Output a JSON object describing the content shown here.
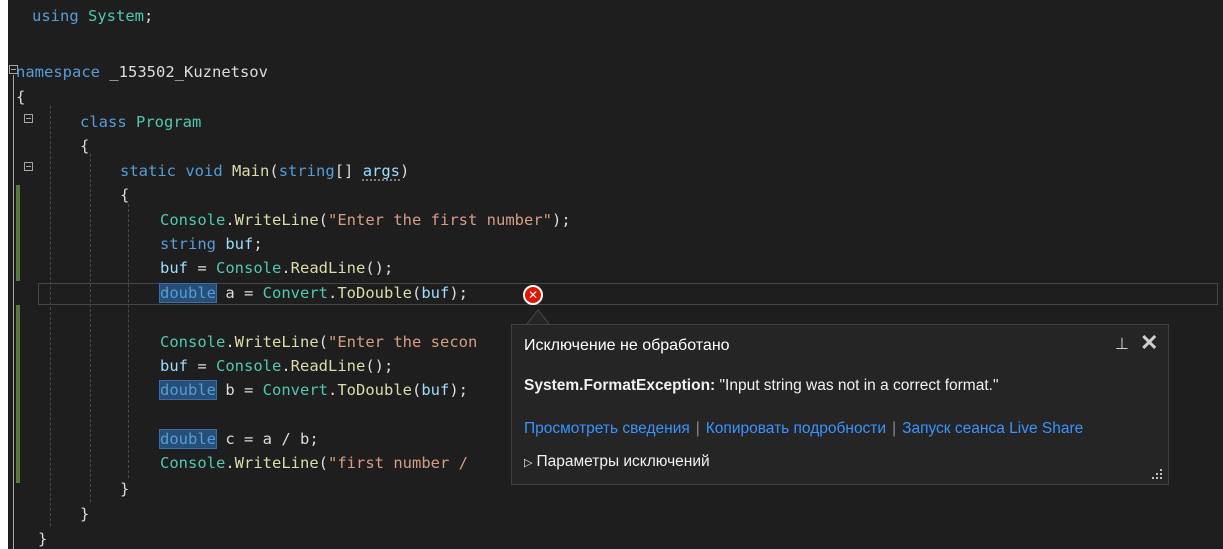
{
  "editor": {
    "lines": [
      {
        "id": "using",
        "tokens": [
          {
            "t": "using",
            "c": "kw"
          },
          {
            "t": " ",
            "c": "plain"
          },
          {
            "t": "System",
            "c": "ty"
          },
          {
            "t": ";",
            "c": "plain"
          }
        ]
      },
      {
        "id": "namespace",
        "tokens": [
          {
            "t": "namespace",
            "c": "kw"
          },
          {
            "t": " _153502_Kuznetsov",
            "c": "plain"
          }
        ]
      },
      {
        "id": "ns-open",
        "tokens": [
          {
            "t": "{",
            "c": "plain"
          }
        ]
      },
      {
        "id": "class",
        "tokens": [
          {
            "t": "class",
            "c": "kw"
          },
          {
            "t": " ",
            "c": "plain"
          },
          {
            "t": "Program",
            "c": "ty"
          }
        ]
      },
      {
        "id": "class-open",
        "tokens": [
          {
            "t": "{",
            "c": "plain"
          }
        ]
      },
      {
        "id": "main",
        "tokens": [
          {
            "t": "static",
            "c": "kw"
          },
          {
            "t": " ",
            "c": "plain"
          },
          {
            "t": "void",
            "c": "kw"
          },
          {
            "t": " ",
            "c": "plain"
          },
          {
            "t": "Main",
            "c": "meth"
          },
          {
            "t": "(",
            "c": "plain"
          },
          {
            "t": "string",
            "c": "kw"
          },
          {
            "t": "[] ",
            "c": "plain"
          },
          {
            "t": "args",
            "c": "var squig"
          },
          {
            "t": ")",
            "c": "plain"
          }
        ]
      },
      {
        "id": "main-open",
        "tokens": [
          {
            "t": "{",
            "c": "plain"
          }
        ]
      },
      {
        "id": "wl1",
        "tokens": [
          {
            "t": "Console",
            "c": "ty"
          },
          {
            "t": ".",
            "c": "plain"
          },
          {
            "t": "WriteLine",
            "c": "meth"
          },
          {
            "t": "(",
            "c": "plain"
          },
          {
            "t": "\"Enter the first number\"",
            "c": "str"
          },
          {
            "t": ");",
            "c": "plain"
          }
        ]
      },
      {
        "id": "decl-buf",
        "tokens": [
          {
            "t": "string",
            "c": "kw"
          },
          {
            "t": " ",
            "c": "plain"
          },
          {
            "t": "buf",
            "c": "var"
          },
          {
            "t": ";",
            "c": "plain"
          }
        ]
      },
      {
        "id": "read1",
        "tokens": [
          {
            "t": "buf",
            "c": "var"
          },
          {
            "t": " = ",
            "c": "plain"
          },
          {
            "t": "Console",
            "c": "ty"
          },
          {
            "t": ".",
            "c": "plain"
          },
          {
            "t": "ReadLine",
            "c": "meth"
          },
          {
            "t": "();",
            "c": "plain"
          }
        ]
      },
      {
        "id": "decl-a",
        "tokens": [
          {
            "t": "double",
            "c": "kw sel"
          },
          {
            "t": " a = ",
            "c": "plain"
          },
          {
            "t": "Convert",
            "c": "ty"
          },
          {
            "t": ".",
            "c": "plain"
          },
          {
            "t": "ToDouble",
            "c": "meth"
          },
          {
            "t": "(",
            "c": "plain"
          },
          {
            "t": "buf",
            "c": "var"
          },
          {
            "t": ");",
            "c": "plain"
          }
        ]
      },
      {
        "id": "blank1",
        "tokens": []
      },
      {
        "id": "wl2",
        "tokens": [
          {
            "t": "Console",
            "c": "ty"
          },
          {
            "t": ".",
            "c": "plain"
          },
          {
            "t": "WriteLine",
            "c": "meth"
          },
          {
            "t": "(",
            "c": "plain"
          },
          {
            "t": "\"Enter the secon",
            "c": "str"
          }
        ]
      },
      {
        "id": "read2",
        "tokens": [
          {
            "t": "buf",
            "c": "var"
          },
          {
            "t": " = ",
            "c": "plain"
          },
          {
            "t": "Console",
            "c": "ty"
          },
          {
            "t": ".",
            "c": "plain"
          },
          {
            "t": "ReadLine",
            "c": "meth"
          },
          {
            "t": "();",
            "c": "plain"
          }
        ]
      },
      {
        "id": "decl-b",
        "tokens": [
          {
            "t": "double",
            "c": "kw sel"
          },
          {
            "t": " b = ",
            "c": "plain"
          },
          {
            "t": "Convert",
            "c": "ty"
          },
          {
            "t": ".",
            "c": "plain"
          },
          {
            "t": "ToDouble",
            "c": "meth"
          },
          {
            "t": "(",
            "c": "plain"
          },
          {
            "t": "buf",
            "c": "var"
          },
          {
            "t": ");",
            "c": "plain"
          }
        ]
      },
      {
        "id": "blank2",
        "tokens": []
      },
      {
        "id": "decl-c",
        "tokens": [
          {
            "t": "double",
            "c": "kw sel"
          },
          {
            "t": " c = a / b;",
            "c": "plain"
          }
        ]
      },
      {
        "id": "wl3",
        "tokens": [
          {
            "t": "Console",
            "c": "ty"
          },
          {
            "t": ".",
            "c": "plain"
          },
          {
            "t": "WriteLine",
            "c": "meth"
          },
          {
            "t": "(",
            "c": "plain"
          },
          {
            "t": "\"first number / ",
            "c": "str"
          }
        ]
      },
      {
        "id": "main-close",
        "tokens": [
          {
            "t": "}",
            "c": "plain"
          }
        ]
      },
      {
        "id": "class-close",
        "tokens": [
          {
            "t": "}",
            "c": "plain"
          }
        ]
      },
      {
        "id": "ns-close",
        "tokens": [
          {
            "t": "}",
            "c": "plain"
          }
        ]
      }
    ]
  },
  "exception_popup": {
    "title": "Исключение не обработано",
    "pin_icon": "pin-icon",
    "close_icon": "close-icon",
    "exception_type": "System.FormatException:",
    "exception_message": " \"Input string was not in a correct format.\"",
    "links": [
      "Просмотреть сведения",
      "Копировать подробности",
      "Запуск сеанса Live Share"
    ],
    "options_label": "Параметры исключений",
    "colors": {
      "link": "#3794ff",
      "error_icon": "#e51400"
    }
  }
}
